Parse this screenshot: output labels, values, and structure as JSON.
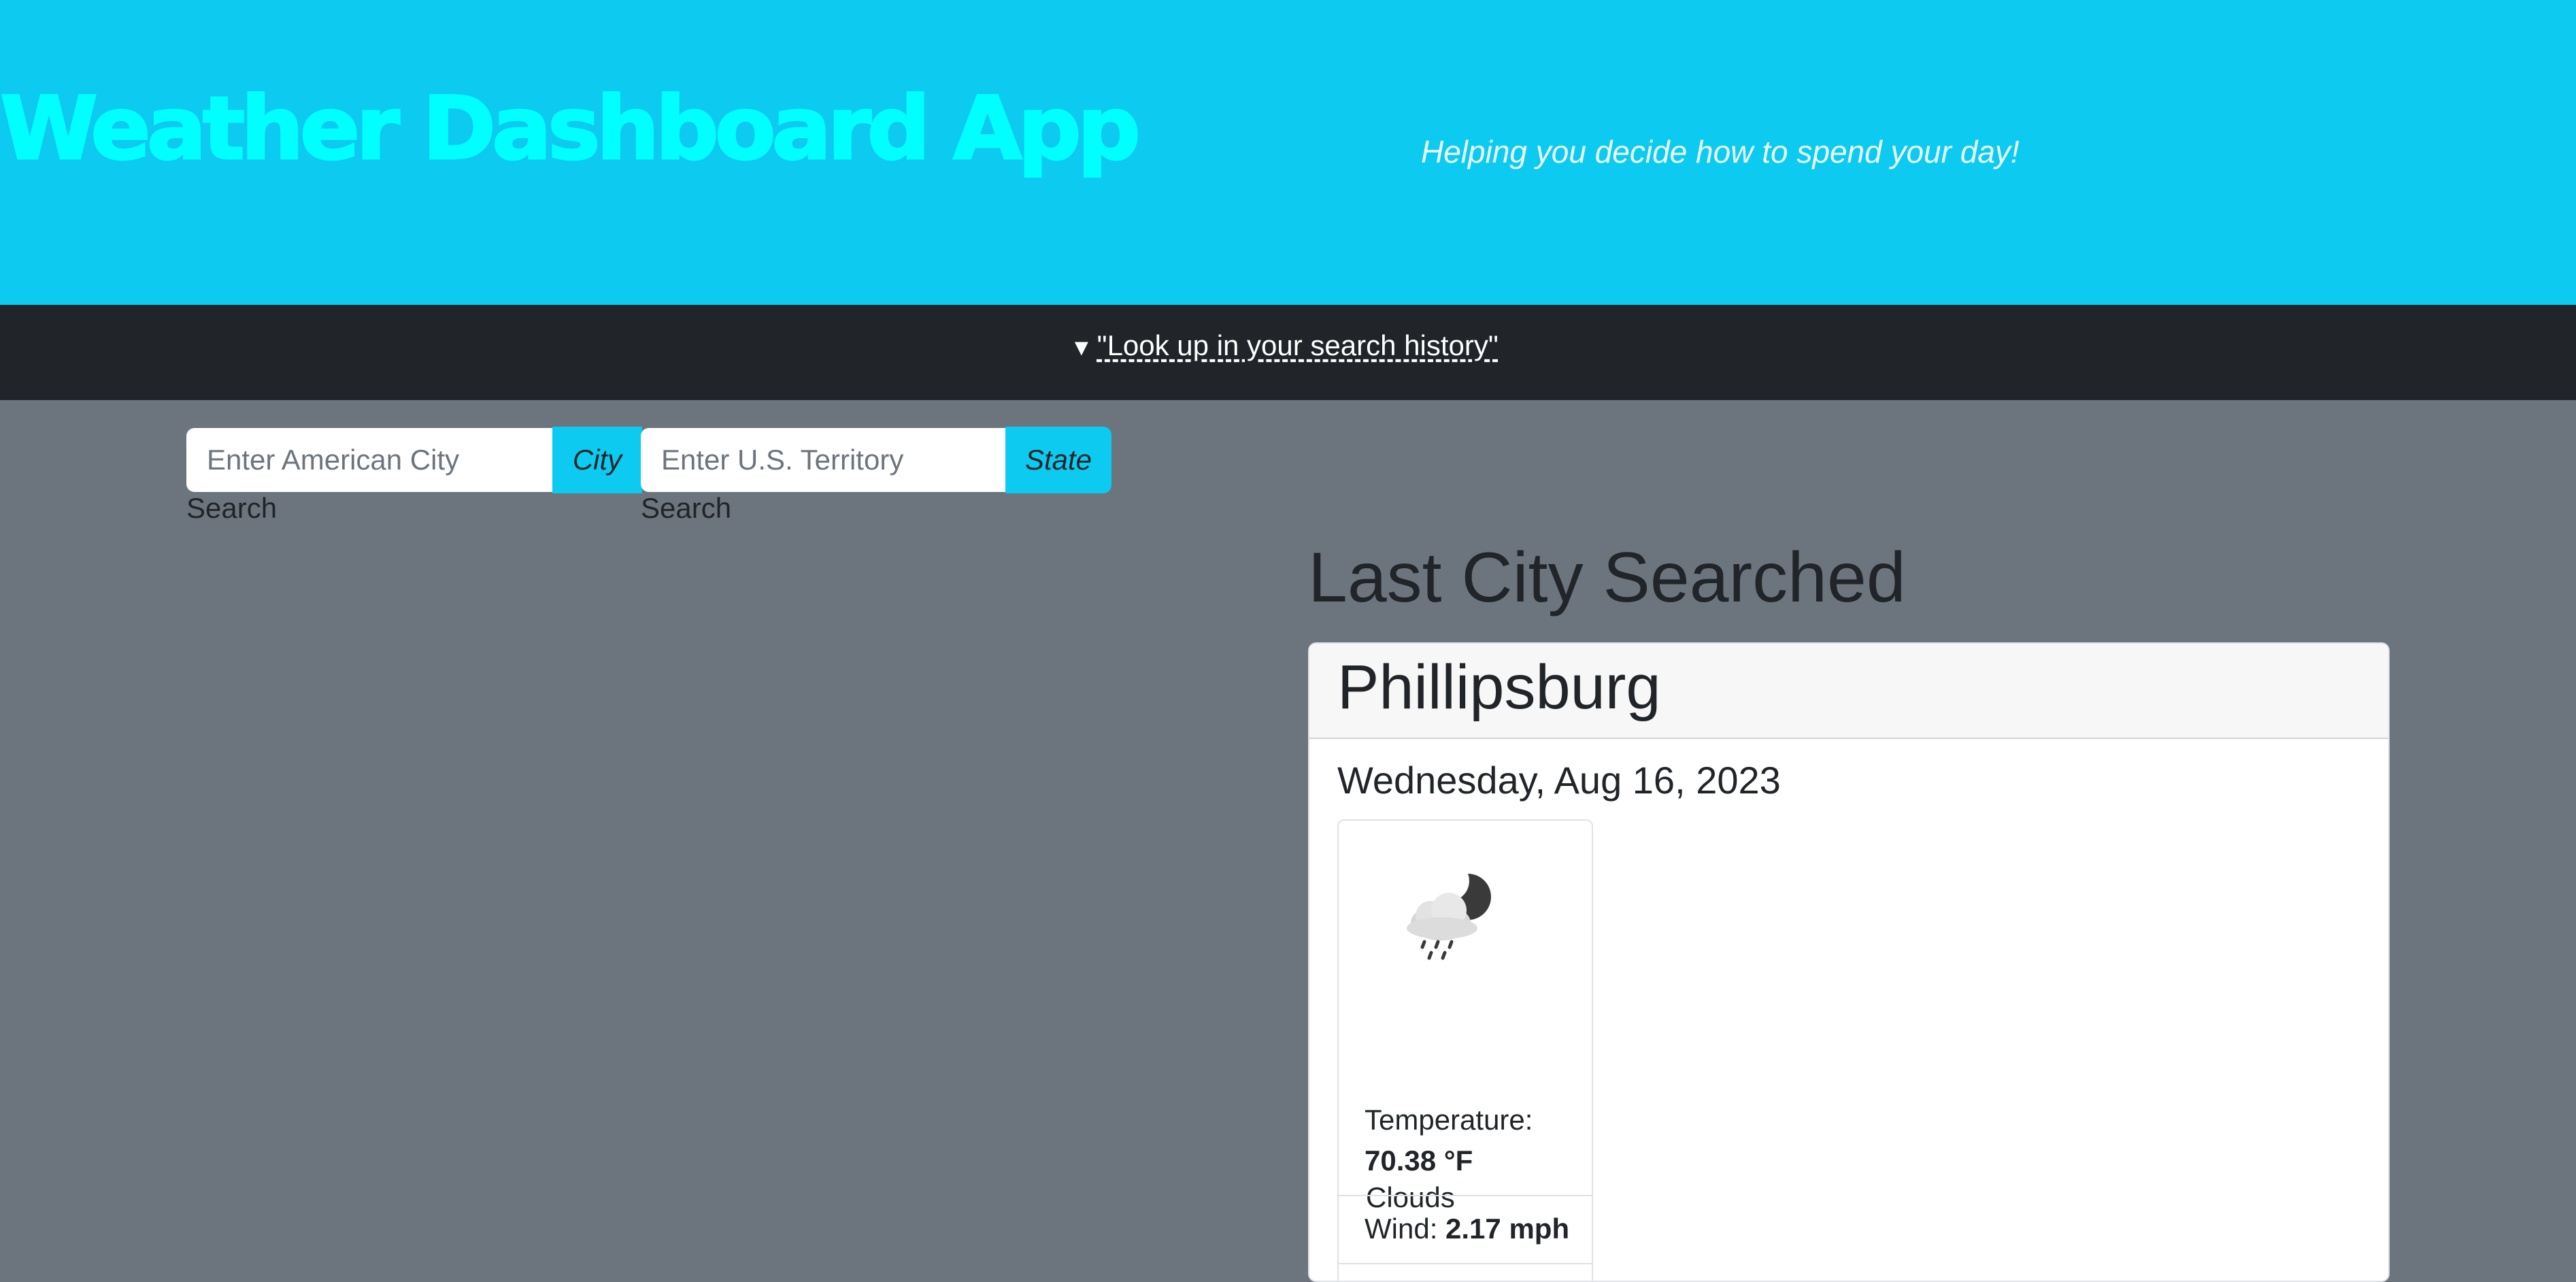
{
  "header": {
    "title": "Weather Dashboard App",
    "tagline": "Helping you decide how to spend your day!"
  },
  "history": {
    "toggle_label": "\"Look up in your search history\""
  },
  "search": {
    "city_placeholder": "Enter American City",
    "city_button": "City",
    "city_caption": "Search",
    "state_placeholder": "Enter U.S. Territory",
    "state_button": "State",
    "state_caption": "Search"
  },
  "main": {
    "section_title": "Last City Searched",
    "city": "Phillipsburg",
    "date": "Wednesday, Aug 16, 2023",
    "condition": "Clouds",
    "icon": "cloud-moon-rain-icon",
    "temperature_label": "Temperature:",
    "temperature_value": "70.38 °F",
    "wind_label": "Wind:",
    "wind_value": "2.17 mph"
  },
  "colors": {
    "header_bg": "#0dcaf0",
    "title": "#00ffff",
    "history_bar": "#212529",
    "page_bg": "#6c757d",
    "button": "#0dcaf0"
  }
}
